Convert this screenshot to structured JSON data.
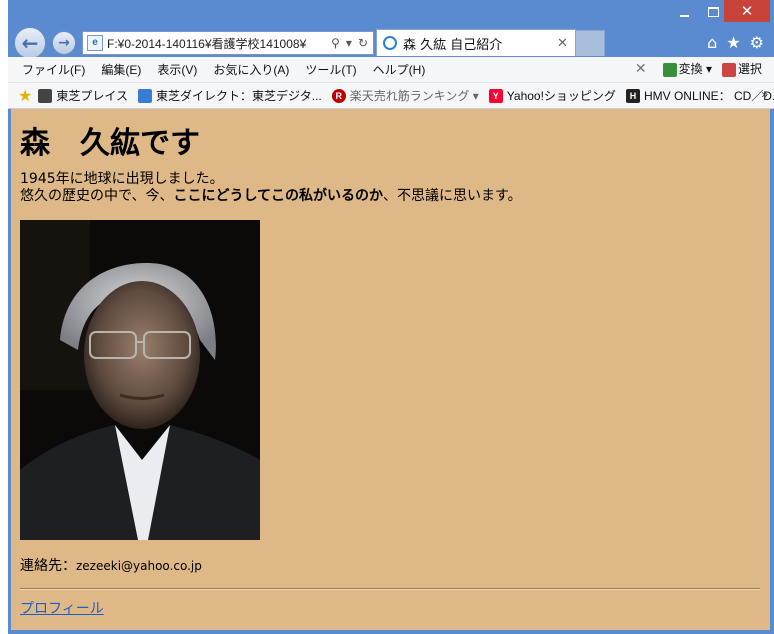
{
  "tab": {
    "title": "森 久紘 自己紹介"
  },
  "address": {
    "url": "F:¥0-2014-140116¥看護学校141008¥"
  },
  "menu": [
    "ファイル(F)",
    "編集(E)",
    "表示(V)",
    "お気に入り(A)",
    "ツール(T)",
    "ヘルプ(H)"
  ],
  "menu_right": {
    "convert": "変換",
    "select": "選択"
  },
  "favorites": [
    {
      "label": "東芝プレイス",
      "color": "#444444"
    },
    {
      "label": "東芝ダイレクト：東芝デジタ...",
      "color": "#3a7bd5"
    },
    {
      "label": "楽天売れ筋ランキング",
      "color": "#bf0000"
    },
    {
      "label": "Yahoo!ショッピング",
      "color": "#ff0033"
    },
    {
      "label": "HMV ONLINE： CD／D...",
      "color": "#222222"
    }
  ],
  "page": {
    "title": "森　久紘です",
    "line1": "1945年に地球に出現しました。",
    "line2_pre": "悠久の歴史の中で、今、",
    "line2_bold": "ここにどうしてこの私がいるのか",
    "line2_post": "、不思議に思います。",
    "contact_label": "連絡先：",
    "contact_email": "zezeeki@yahoo.co.jp",
    "profile_link": "プロフィール"
  },
  "colors": {
    "content_bg": "#deb887",
    "window_frame": "#5a8bd0",
    "link": "#1f5ec9"
  }
}
